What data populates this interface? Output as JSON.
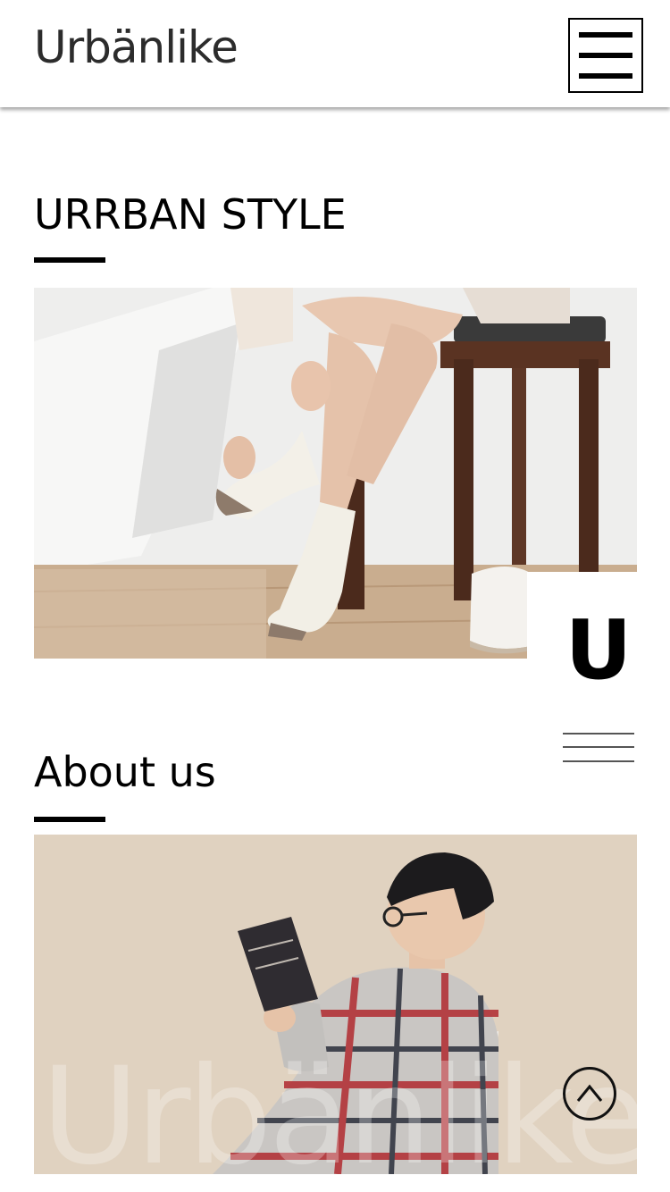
{
  "header": {
    "logo": "Urbänlike",
    "menu_icon": "hamburger-menu-icon"
  },
  "sections": [
    {
      "title": "URRBAN STYLE",
      "image": "photo-woman-pulling-on-white-socks"
    },
    {
      "title": "About us",
      "image": "photo-man-in-plaid-pajamas-reading-book"
    }
  ],
  "side_badge": {
    "letter": "U"
  },
  "watermark": "Urbänlike",
  "scroll_top_icon": "chevron-up-circle-icon"
}
